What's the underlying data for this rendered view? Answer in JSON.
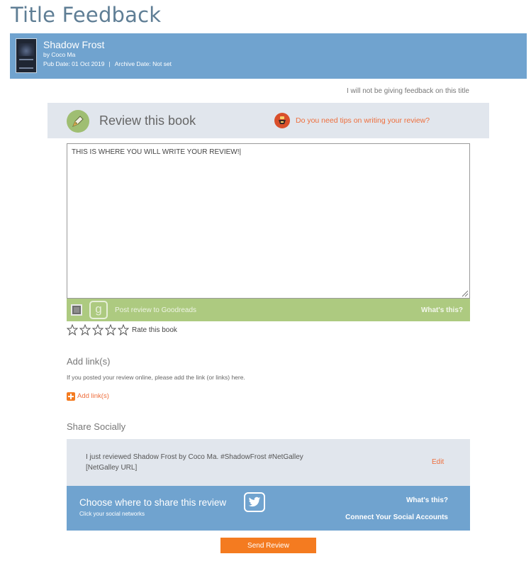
{
  "page": {
    "title": "Title Feedback"
  },
  "book": {
    "title": "Shadow Frost",
    "author": "by Coco Ma",
    "pub_date": "Pub Date: 01 Oct 2019",
    "separator": "|",
    "archive_date": "Archive Date: Not set"
  },
  "no_feedback_link": "I will not be giving feedback on this title",
  "review": {
    "header_title": "Review this book",
    "tips_link": "Do you need tips on writing your review?",
    "text": "THIS IS WHERE YOU  WILL WRITE YOUR REVIEW!|"
  },
  "goodreads": {
    "logo_letter": "g",
    "checkbox_label": "Post review to Goodreads",
    "whats_this": "What's this?"
  },
  "rating": {
    "label": "Rate this book",
    "stars_selected": 0,
    "stars_total": 5
  },
  "links": {
    "title": "Add link(s)",
    "help": "If you posted your review online, please add the link (or links) here.",
    "add_label": "Add link(s)"
  },
  "share": {
    "title": "Share Socially",
    "message_line1": "I just reviewed Shadow Frost by Coco Ma. #ShadowFrost #NetGalley",
    "message_line2": "[NetGalley URL]",
    "edit": "Edit",
    "choose": "Choose where to share this review",
    "choose_sub": "Click your social networks",
    "whats_this": "What's this?",
    "connect": "Connect Your Social Accounts"
  },
  "send_button": "Send Review",
  "colors": {
    "accent_blue": "#70a3cf",
    "accent_orange": "#f47b20",
    "accent_green": "#adca80"
  }
}
